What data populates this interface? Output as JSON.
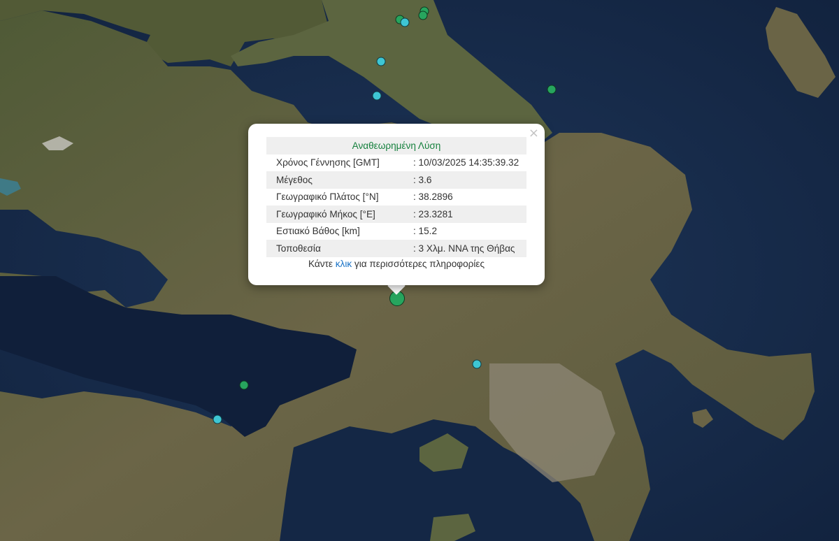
{
  "popup": {
    "header": "Αναθεωρημένη Λύση",
    "close_symbol": "×",
    "rows": [
      {
        "label": "Χρόνος Γέννησης [GMT]",
        "value": ": 10/03/2025 14:35:39.32"
      },
      {
        "label": "Μέγεθος",
        "value": ": 3.6"
      },
      {
        "label": "Γεωγραφικό Πλάτος [°N]",
        "value": ": 38.2896"
      },
      {
        "label": "Γεωγραφικό Μήκος [°E]",
        "value": ": 23.3281"
      },
      {
        "label": "Εστιακό Βάθος [km]",
        "value": ": 15.2"
      },
      {
        "label": "Τοποθεσία",
        "value": ": 3 Χλμ. ΝΝΑ της Θήβας"
      }
    ],
    "more_prefix": "Κάντε ",
    "more_link": "κλικ",
    "more_suffix": " για περισσότερες πληροφορίες"
  },
  "colors": {
    "marker_recent": "#3ec6d4",
    "marker_older": "#27a55e",
    "header_text": "#15803d",
    "link": "#1a73c7"
  },
  "map_style": "satellite imagery"
}
